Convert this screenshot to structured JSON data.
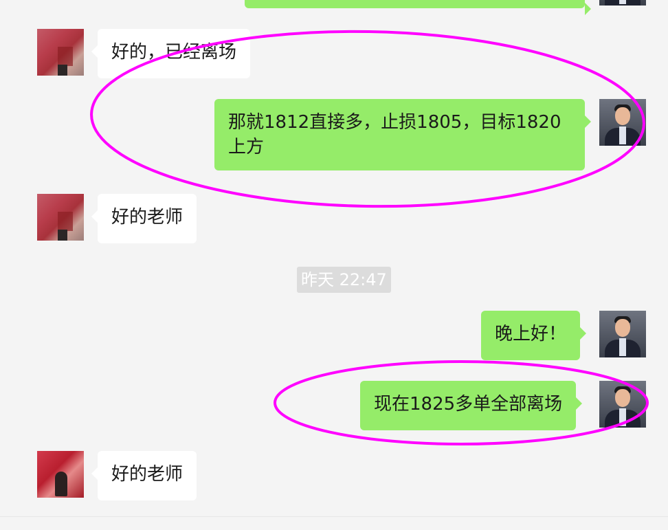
{
  "messages": [
    {
      "id": "m0",
      "side": "out",
      "text": ""
    },
    {
      "id": "m1",
      "side": "in",
      "text": "好的，已经离场"
    },
    {
      "id": "m2",
      "side": "out",
      "text": "那就1812直接多，止损1805，目标1820上方"
    },
    {
      "id": "m3",
      "side": "in",
      "text": "好的老师"
    },
    {
      "id": "m4",
      "side": "out",
      "text": "晚上好！"
    },
    {
      "id": "m5",
      "side": "out",
      "text": "现在1825多单全部离场"
    },
    {
      "id": "m6",
      "side": "in",
      "text": "好的老师"
    }
  ],
  "timestamp": "昨天 22:47",
  "colors": {
    "outgoing_bubble": "#95ec69",
    "incoming_bubble": "#ffffff",
    "annotation": "#ff00ff",
    "background": "#f4f4f4"
  }
}
